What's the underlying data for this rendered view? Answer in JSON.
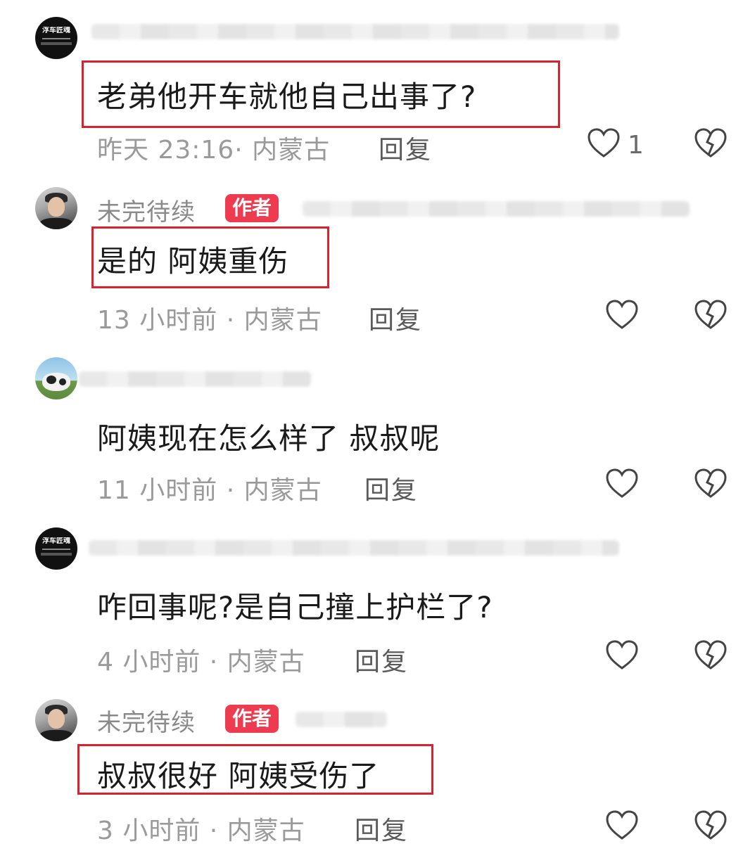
{
  "comments": [
    {
      "avatar": "brand-logo-avatar",
      "avatar_text": "浮车匠魂",
      "username": "",
      "is_author": false,
      "content": "老弟他开车就他自己出事了?",
      "highlighted": true,
      "time_location": "昨天 23:16· 内蒙古",
      "reply_label": "回复",
      "like_count": "1"
    },
    {
      "avatar": "person-avatar",
      "username": "未完待续",
      "is_author": true,
      "author_label": "作者",
      "content": "是的 阿姨重伤",
      "highlighted": true,
      "time_location": "13 小时前 · 内蒙古",
      "reply_label": "回复",
      "like_count": ""
    },
    {
      "avatar": "cow-avatar",
      "username": "",
      "is_author": false,
      "content": "阿姨现在怎么样了 叔叔呢",
      "highlighted": false,
      "time_location": "11 小时前 · 内蒙古",
      "reply_label": "回复",
      "like_count": ""
    },
    {
      "avatar": "brand-logo-avatar",
      "avatar_text": "浮车匠魂",
      "username": "",
      "is_author": false,
      "content": "咋回事呢?是自己撞上护栏了?",
      "highlighted": false,
      "time_location": "4 小时前 · 内蒙古",
      "reply_label": "回复",
      "like_count": ""
    },
    {
      "avatar": "person-avatar",
      "username": "未完待续",
      "is_author": true,
      "author_label": "作者",
      "content": "叔叔很好  阿姨受伤了",
      "highlighted": true,
      "time_location": "3 小时前 · 内蒙古",
      "reply_label": "回复",
      "like_count": ""
    }
  ],
  "colors": {
    "highlight_box": "#d8232f",
    "author_badge": "#ef3b50",
    "meta_text": "#9a9a9a"
  },
  "icons": [
    "heart-outline-icon",
    "broken-heart-icon"
  ]
}
